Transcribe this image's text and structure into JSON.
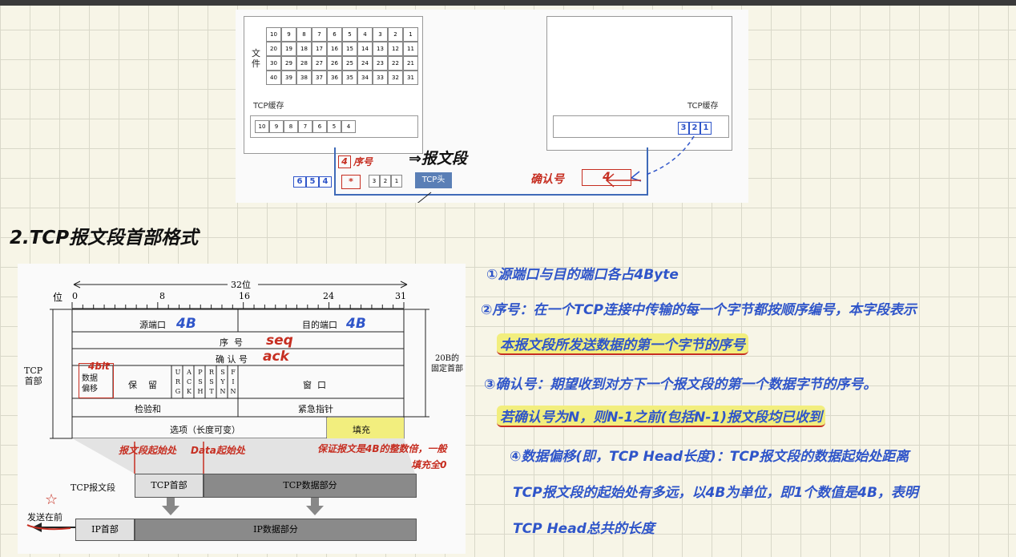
{
  "top_figure": {
    "file_label": "文\n件",
    "file_grid": [
      [
        "10",
        "9",
        "8",
        "7",
        "6",
        "5",
        "4",
        "3",
        "2",
        "1"
      ],
      [
        "20",
        "19",
        "18",
        "17",
        "16",
        "15",
        "14",
        "13",
        "12",
        "11"
      ],
      [
        "30",
        "29",
        "28",
        "27",
        "26",
        "25",
        "24",
        "23",
        "22",
        "21"
      ],
      [
        "40",
        "39",
        "38",
        "37",
        "36",
        "35",
        "34",
        "33",
        "32",
        "31"
      ]
    ],
    "left_buffer_label": "TCP缓存",
    "left_buffer_cells": [
      "10",
      "9",
      "8",
      "7",
      "6",
      "5",
      "4"
    ],
    "right_buffer_label": "TCP缓存",
    "right_buffer_cells": [
      "3",
      "2",
      "1"
    ],
    "segment_cells": [
      "3",
      "2",
      "1"
    ],
    "segment_header": "TCP头",
    "note_seq_box": "4",
    "note_seq_label": "序号",
    "note_segment": "⇒报文段",
    "note_bytes": [
      "6",
      "5",
      "4"
    ],
    "note_star": "*",
    "note_ack_label": "确认号",
    "note_ack_value": "4"
  },
  "section_title": "2.TCP报文段首部格式",
  "diagram": {
    "width_label": "32位",
    "bit_axis_label": "位",
    "bits": [
      "0",
      "8",
      "16",
      "24",
      "31"
    ],
    "fields": {
      "src_port": "源端口",
      "dst_port": "目的端口",
      "seq": "序  号",
      "ack": "确 认 号",
      "offset": "数据\n偏移",
      "reserved": "保    留",
      "flags": [
        "U\nR\nG",
        "A\nC\nK",
        "P\nS\nH",
        "R\nS\nT",
        "S\nY\nN",
        "F\nI\nN"
      ],
      "window": "窗  口",
      "checksum": "检验和",
      "urgent": "紧急指针",
      "options": "选项（长度可变）",
      "padding": "填充"
    },
    "tcp_header_label": "TCP\n首部",
    "fixed_header_label": "20B的\n固定首部",
    "segment_label": "TCP报文段",
    "segment_header": "TCP首部",
    "segment_data": "TCP数据部分",
    "ip_header": "IP首部",
    "ip_data": "IP数据部分",
    "send_first": "发送在前",
    "anno_4b_src": "4B",
    "anno_4b_dst": "4B",
    "anno_seq": "seq",
    "anno_ack": "ack",
    "anno_4bit": "4bit",
    "anno_segment_start": "报文段起始处",
    "anno_data_start": "Data起始处",
    "anno_padding": "保证报文是4B的整数倍，一般\n填充全0"
  },
  "notes": [
    "①源端口与目的端口各占4Byte",
    "②序号：在一个TCP连接中传输的每一个字节都按顺序编号，本字段表示",
    "本报文段所发送数据的第一个字节的序号",
    "③确认号：期望收到对方下一个报文段的第一个数据字节的序号。",
    "若确认号为N，则N-1之前(包括N-1)报文段均已收到",
    "④数据偏移(即，TCP Head长度)：TCP报文段的数据起始处距离",
    "TCP报文段的起始处有多远，以4B为单位，即1个数值是4B，表明",
    "TCP Head总共的长度"
  ]
}
